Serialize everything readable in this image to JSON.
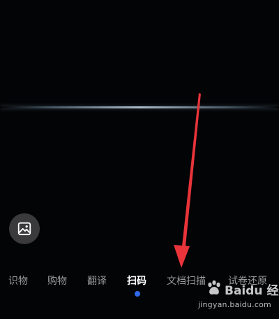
{
  "modes": {
    "items": [
      {
        "label": "识物"
      },
      {
        "label": "购物"
      },
      {
        "label": "翻译"
      },
      {
        "label": "扫码"
      },
      {
        "label": "文档扫描"
      },
      {
        "label": "试卷还原"
      }
    ],
    "active_label": "扫码"
  },
  "gallery": {
    "icon": "image-icon"
  },
  "annotation": {
    "arrow_color": "#e8343a"
  },
  "watermark": {
    "brand": "Baidu 经验",
    "url": "jingyan.baidu.com"
  },
  "colors": {
    "active_dot": "#2f6ae8",
    "active_text": "#ffffff",
    "inactive_text": "#9a9a9a"
  }
}
